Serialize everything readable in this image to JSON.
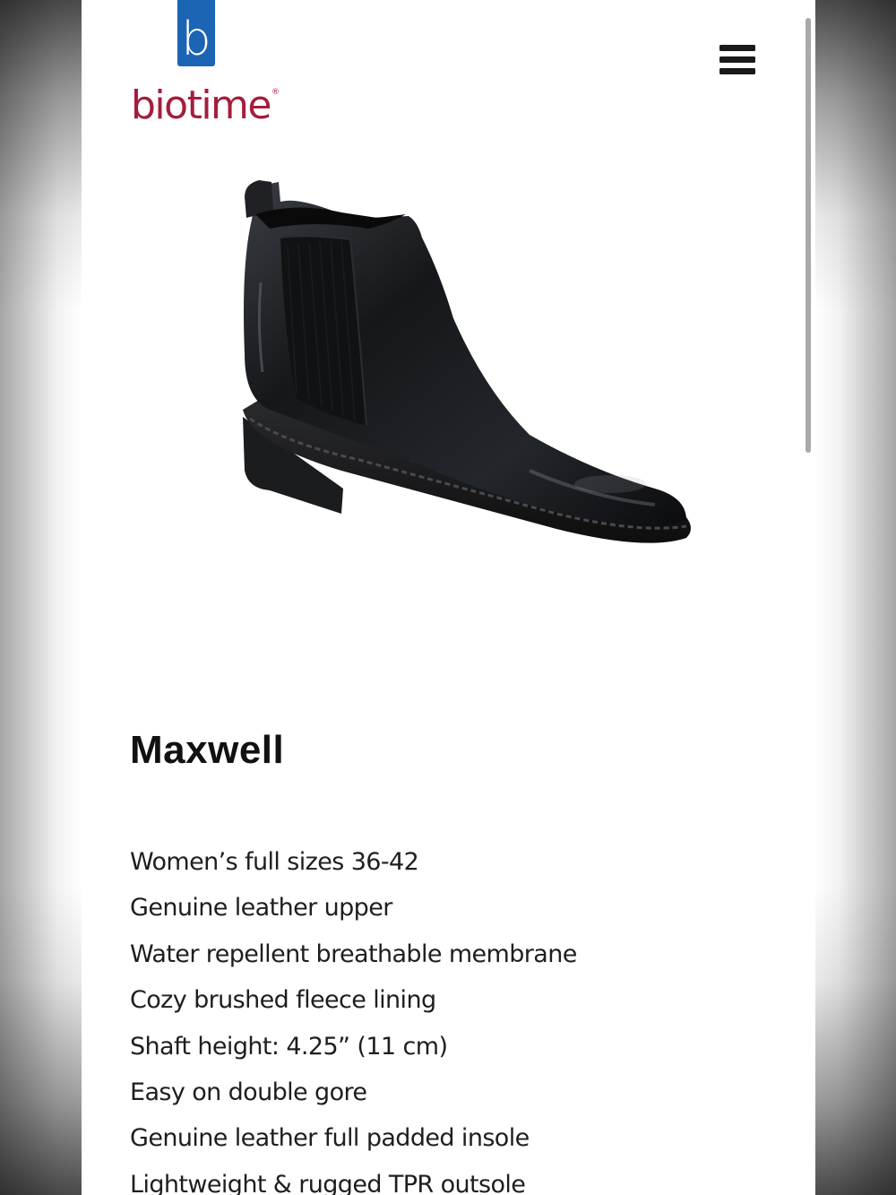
{
  "brand": {
    "logo_letter": "b",
    "name": "biotime",
    "registered_mark": "®",
    "colors": {
      "mark": "#1c64b4",
      "wordmark": "#a51d3c"
    }
  },
  "header": {
    "menu_icon": "hamburger-menu-icon"
  },
  "product": {
    "image_alt": "Black leather Chelsea boot",
    "title": "Maxwell",
    "features": [
      "Women’s full sizes 36-42",
      "Genuine leather upper",
      "Water repellent breathable membrane",
      "Cozy brushed fleece lining",
      "Shaft height: 4.25” (11 cm)",
      "Easy on double gore",
      "Genuine leather full padded insole",
      "Lightweight & rugged TPR outsole"
    ]
  }
}
